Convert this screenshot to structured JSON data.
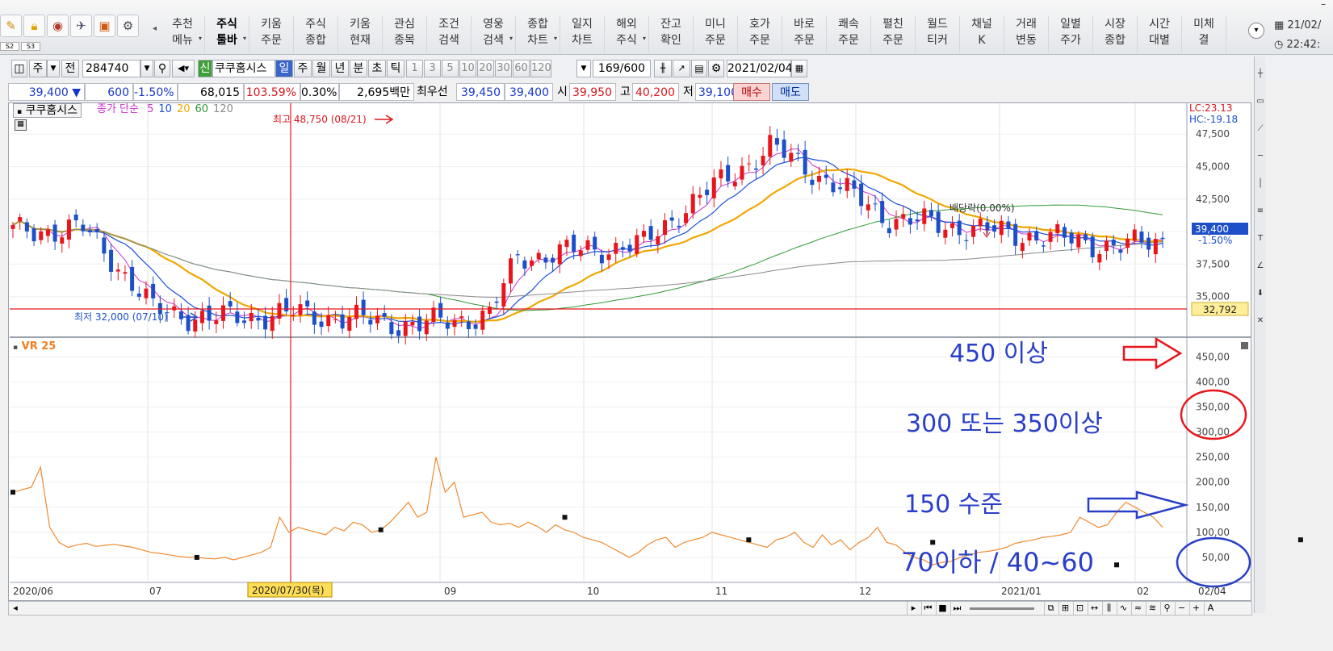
{
  "menubar": {
    "icons": [
      "pencil-icon",
      "lock-icon",
      "camera-icon",
      "pin-icon",
      "presentation-icon",
      "gear-icon"
    ],
    "mini_tabs": [
      "S2",
      "S3"
    ],
    "items": [
      {
        "label": "추천\n메뉴",
        "caret": true
      },
      {
        "label": "주식\n툴바",
        "caret": true,
        "active": true
      },
      {
        "label": "키움\n주문",
        "caret": false
      },
      {
        "label": "주식\n종합",
        "caret": false
      },
      {
        "label": "키움\n현재",
        "caret": false
      },
      {
        "label": "관심\n종목",
        "caret": false
      },
      {
        "label": "조건\n검색",
        "caret": false
      },
      {
        "label": "영웅\n검색",
        "caret": true
      },
      {
        "label": "종합\n차트",
        "caret": true
      },
      {
        "label": "일지\n차트",
        "caret": false
      },
      {
        "label": "해외\n주식",
        "caret": true
      },
      {
        "label": "잔고\n확인",
        "caret": false
      },
      {
        "label": "미니\n주문",
        "caret": false
      },
      {
        "label": "호가\n주문",
        "caret": false
      },
      {
        "label": "바로\n주문",
        "caret": false
      },
      {
        "label": "쾌속\n주문",
        "caret": false
      },
      {
        "label": "펼친\n주문",
        "caret": false
      },
      {
        "label": "월드\n티커",
        "caret": false
      },
      {
        "label": "채널\nK",
        "caret": false
      },
      {
        "label": "거래\n변동",
        "caret": false
      },
      {
        "label": "일별\n주가",
        "caret": false
      },
      {
        "label": "시장\n종합",
        "caret": false
      },
      {
        "label": "시간\n대별",
        "caret": false
      },
      {
        "label": "미체\n결",
        "caret": false
      }
    ],
    "date": "21/02/",
    "time": "22:42:"
  },
  "toolbar1": {
    "mode1": "주",
    "mode2": "전",
    "code": "284740",
    "badge": "신",
    "stock_name": "쿠쿠홈시스",
    "periods": [
      "일",
      "주",
      "월",
      "년",
      "분",
      "초",
      "틱"
    ],
    "selected_period": "일",
    "intervals": [
      "1",
      "3",
      "5",
      "10",
      "20",
      "30",
      "60",
      "120"
    ],
    "count": "169",
    "count_total": "/600",
    "date": "2021/02/04"
  },
  "toolbar2": {
    "price": "39,400",
    "arrow": "▼",
    "change": "600",
    "change_pct": "-1.50%",
    "volume": "68,015",
    "volume_ratio": "103.59%",
    "turnover": "0.30%",
    "amount": "2,695백만",
    "best_label": "최우선",
    "ask": "39,450",
    "bid": "39,400",
    "open_label": "시",
    "open": "39,950",
    "high_label": "고",
    "high": "40,200",
    "low_label": "저",
    "low": "39,100",
    "buy": "매수",
    "sell": "매도"
  },
  "chart": {
    "legend_name": "쿠쿠홈시스",
    "ma_label": "종가 단순",
    "ma": [
      {
        "period": "5",
        "color": "#cc33cc"
      },
      {
        "period": "10",
        "color": "#1b4ed8"
      },
      {
        "period": "20",
        "color": "#f0a800"
      },
      {
        "period": "60",
        "color": "#2f9b35"
      },
      {
        "period": "120",
        "color": "#8a8a8a"
      }
    ],
    "lc": "LC:23.13",
    "hc": "HC:-19.18",
    "high_annot": "최고 48,750 (08/21)",
    "low_annot": "최저 32,000 (07/10)",
    "dividend_annot": "배당락(0.00%)",
    "current_price": "39,400",
    "current_pct": "-1.50%",
    "ref_price": "32,792",
    "vr_label": "VR 25",
    "x_axis": [
      {
        "label": "2020/06"
      },
      {
        "label": "07"
      },
      {
        "label": "09"
      },
      {
        "label": "10"
      },
      {
        "label": "11"
      },
      {
        "label": "12"
      },
      {
        "label": "2021/01"
      },
      {
        "label": "02"
      },
      {
        "label": "02/04"
      }
    ],
    "cursor_date": "2020/07/30(목)",
    "annotations": {
      "a450": "450 이상",
      "a300": "300 또는 350이상",
      "a150": "150 수준",
      "a70": "70이하 / 40~60"
    },
    "colors": {
      "up": "#e8161c",
      "down": "#1d50c8",
      "vr": "#f08a30",
      "annot": "#2a3fc8"
    }
  },
  "chart_data": [
    {
      "type": "candlestick",
      "title": "쿠쿠홈시스",
      "ylim": [
        32000,
        48750
      ],
      "yticks": [
        "47,500",
        "45,000",
        "42,500",
        "40,000",
        "37,500",
        "35,000"
      ],
      "high": 48750,
      "low": 32000,
      "current": 39400,
      "reference_line": 32792
    },
    {
      "type": "line",
      "title": "VR 25",
      "ylim": [
        0,
        470
      ],
      "yticks": [
        "450,00",
        "400,00",
        "350,00",
        "300,00",
        "250,00",
        "200,00",
        "150,00",
        "100,00",
        "50,00"
      ],
      "values": [
        180,
        185,
        190,
        230,
        110,
        80,
        70,
        75,
        78,
        72,
        74,
        76,
        73,
        70,
        65,
        60,
        58,
        55,
        52,
        50,
        50,
        48,
        47,
        50,
        45,
        50,
        55,
        60,
        70,
        130,
        100,
        110,
        105,
        100,
        95,
        110,
        103,
        120,
        115,
        100,
        105,
        120,
        140,
        160,
        130,
        140,
        250,
        180,
        200,
        130,
        135,
        140,
        120,
        115,
        118,
        110,
        120,
        112,
        100,
        115,
        105,
        100,
        90,
        85,
        80,
        70,
        60,
        50,
        60,
        75,
        85,
        90,
        70,
        80,
        85,
        90,
        100,
        95,
        90,
        85,
        80,
        75,
        70,
        85,
        90,
        100,
        80,
        70,
        95,
        75,
        85,
        65,
        80,
        90,
        110,
        80,
        75,
        60,
        50,
        45,
        35,
        40,
        42,
        50,
        55,
        60,
        62,
        65,
        70,
        78,
        82,
        85,
        90,
        92,
        95,
        100,
        130,
        120,
        110,
        115,
        140,
        160,
        150,
        140,
        130,
        110
      ],
      "markers": [
        {
          "i": 0,
          "v": 180
        },
        {
          "i": 20,
          "v": 50
        },
        {
          "i": 40,
          "v": 105
        },
        {
          "i": 60,
          "v": 130
        },
        {
          "i": 80,
          "v": 85
        },
        {
          "i": 100,
          "v": 80
        },
        {
          "i": 120,
          "v": 35
        },
        {
          "i": 140,
          "v": 85
        },
        {
          "i": 159,
          "v": 110
        }
      ]
    }
  ]
}
